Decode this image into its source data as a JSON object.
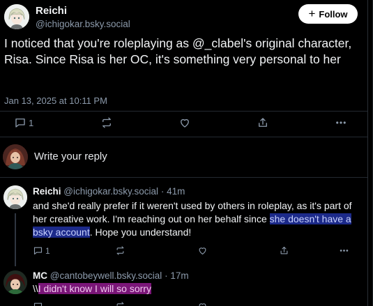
{
  "post": {
    "author_name": "Reichi",
    "author_handle": "@ichigokar.bsky.social",
    "follow_label": "Follow",
    "text": "I noticed that you're roleplaying as @_clabel's original character, Risa. Since Risa is her OC, it's something very personal to her",
    "date": "Jan 13, 2025 at 10:11 PM",
    "reply_count": "1",
    "icons": [
      "reply-icon",
      "repost-icon",
      "like-icon",
      "share-icon",
      "more-icon"
    ]
  },
  "composer": {
    "prompt": "Write your reply"
  },
  "replies": [
    {
      "author_name": "Reichi",
      "author_handle": "@ichigokar.bsky.social",
      "separator": "·",
      "time": "41m",
      "text_before": "and she'd really prefer if it weren't used by others in roleplay, as it's part of her creative work. I'm reaching out on her behalf since ",
      "text_highlight": "she doesn't have a bsky account",
      "text_after": ". Hope you understand!",
      "reply_count": "1",
      "highlight_color": "#1c2a8a"
    },
    {
      "author_name": "MC",
      "author_handle": "@cantobeywell.bsky.social",
      "separator": "·",
      "time": "17m",
      "text_prefix": "\\\\",
      "text_highlight": "I didn't know I will so sorry",
      "highlight_color": "#7a1678"
    }
  ],
  "colors": {
    "background": "#000000",
    "text": "#f1f3f5",
    "muted": "#8c9aab",
    "divider": "#242a31"
  }
}
